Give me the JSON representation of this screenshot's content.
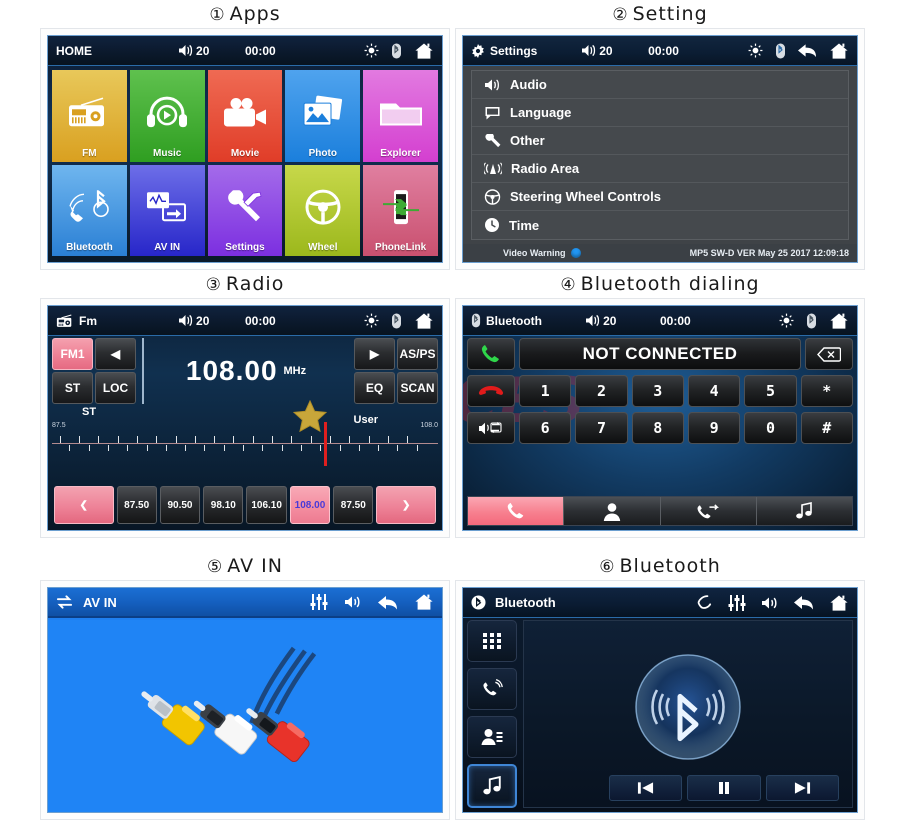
{
  "panels": {
    "apps": {
      "caption_num": "①",
      "caption": "Apps",
      "statusbar": {
        "title": "HOME",
        "volume": "20",
        "clock": "00:00"
      },
      "tiles": [
        {
          "label": "FM",
          "icon": "radio-icon",
          "color1": "#e8c85a",
          "color2": "#d9a020"
        },
        {
          "label": "Music",
          "icon": "headphones-icon",
          "color1": "#5fc14e",
          "color2": "#2f9e21"
        },
        {
          "label": "Movie",
          "icon": "videocamera-icon",
          "color1": "#ef6a53",
          "color2": "#e03d28"
        },
        {
          "label": "Photo",
          "icon": "photo-icon",
          "color1": "#4fa3ee",
          "color2": "#1b7fdc"
        },
        {
          "label": "Explorer",
          "icon": "folder-icon",
          "color1": "#e27ae0",
          "color2": "#d43fd0"
        },
        {
          "label": "Bluetooth",
          "icon": "bt-phone-icon",
          "color1": "#6fb6ef",
          "color2": "#2a7fd4"
        },
        {
          "label": "AV IN",
          "icon": "avin-icon",
          "color1": "#6d6ee8",
          "color2": "#2726c9"
        },
        {
          "label": "Settings",
          "icon": "wrench-icon",
          "color1": "#a46bea",
          "color2": "#7c2fe0"
        },
        {
          "label": "Wheel",
          "icon": "steering-icon",
          "color1": "#c7d84a",
          "color2": "#9cb81c"
        },
        {
          "label": "PhoneLink",
          "icon": "phonelink-icon",
          "color1": "#e07fa0",
          "color2": "#c9506f"
        }
      ]
    },
    "setting": {
      "caption_num": "②",
      "caption": "Setting",
      "statusbar": {
        "title": "Settings",
        "volume": "20",
        "clock": "00:00"
      },
      "items": [
        {
          "label": "Audio",
          "icon": "speaker-icon"
        },
        {
          "label": "Language",
          "icon": "speech-bubble-icon"
        },
        {
          "label": "Other",
          "icon": "wrench-icon"
        },
        {
          "label": "Radio Area",
          "icon": "antenna-icon"
        },
        {
          "label": "Steering Wheel Controls",
          "icon": "steering-icon"
        },
        {
          "label": "Time",
          "icon": "clock-icon"
        }
      ],
      "footer": {
        "warning": "Video Warning",
        "version": "MP5 SW-D VER May 25 2017 12:09:18"
      }
    },
    "radio": {
      "caption_num": "③",
      "caption": "Radio",
      "statusbar": {
        "title": "Fm",
        "volume": "20",
        "clock": "00:00"
      },
      "band": "FM1",
      "buttons": {
        "prev": "◀",
        "next": "▶",
        "st": "ST",
        "loc": "LOC",
        "asps": "AS/PS",
        "eq": "EQ",
        "scan": "SCAN"
      },
      "frequency": "108.00",
      "unit": "MHz",
      "labels": {
        "stereo": "ST",
        "user": "User"
      },
      "scale": {
        "min": "87.5",
        "max": "108.0"
      },
      "presets": [
        "87.50",
        "90.50",
        "98.10",
        "106.10",
        "108.00",
        "87.50"
      ],
      "selected_preset_index": 4,
      "nav_prev": "❮",
      "nav_next": "❯"
    },
    "btdial": {
      "caption_num": "④",
      "caption": "Bluetooth dialing",
      "statusbar": {
        "title": "Bluetooth",
        "volume": "20",
        "clock": "00:00"
      },
      "display": "NOT CONNECTED",
      "keys_row1": [
        "1",
        "2",
        "3",
        "4",
        "5",
        "*"
      ],
      "keys_row2": [
        "6",
        "7",
        "8",
        "9",
        "0",
        "#"
      ],
      "side": {
        "answer": "green-phone-icon",
        "hangup": "red-phone-icon",
        "audio_transfer": "speaker-swap-icon",
        "backspace": "backspace-icon"
      },
      "tabs": [
        {
          "icon": "phone-icon",
          "active": true
        },
        {
          "icon": "contacts-icon",
          "active": false
        },
        {
          "icon": "call-history-icon",
          "active": false
        },
        {
          "icon": "music-note-icon",
          "active": false
        }
      ]
    },
    "avin": {
      "caption_num": "⑤",
      "caption": "AV  IN",
      "statusbar": {
        "title": "AV IN",
        "icons": [
          "equalizer-icon",
          "speaker-icon",
          "back-icon",
          "home-icon"
        ]
      }
    },
    "bt": {
      "caption_num": "⑥",
      "caption": "Bluetooth",
      "statusbar": {
        "title": "Bluetooth",
        "icons": [
          "phone-icon",
          "equalizer-icon",
          "speaker-icon",
          "back-icon",
          "home-icon"
        ]
      },
      "side_buttons": [
        {
          "icon": "keypad-icon",
          "active": false
        },
        {
          "icon": "call-history-icon",
          "active": false
        },
        {
          "icon": "contacts-icon",
          "active": false
        },
        {
          "icon": "music-note-icon",
          "active": true
        }
      ],
      "controls": [
        {
          "icon": "prev-track-icon"
        },
        {
          "icon": "pause-icon"
        },
        {
          "icon": "next-track-icon"
        }
      ]
    }
  },
  "colors": {
    "accent_pink": "#f4869a",
    "status_blue": "#0d2138",
    "avin_blue": "#1f84f5",
    "bt_blue": "#4aa3ff"
  }
}
